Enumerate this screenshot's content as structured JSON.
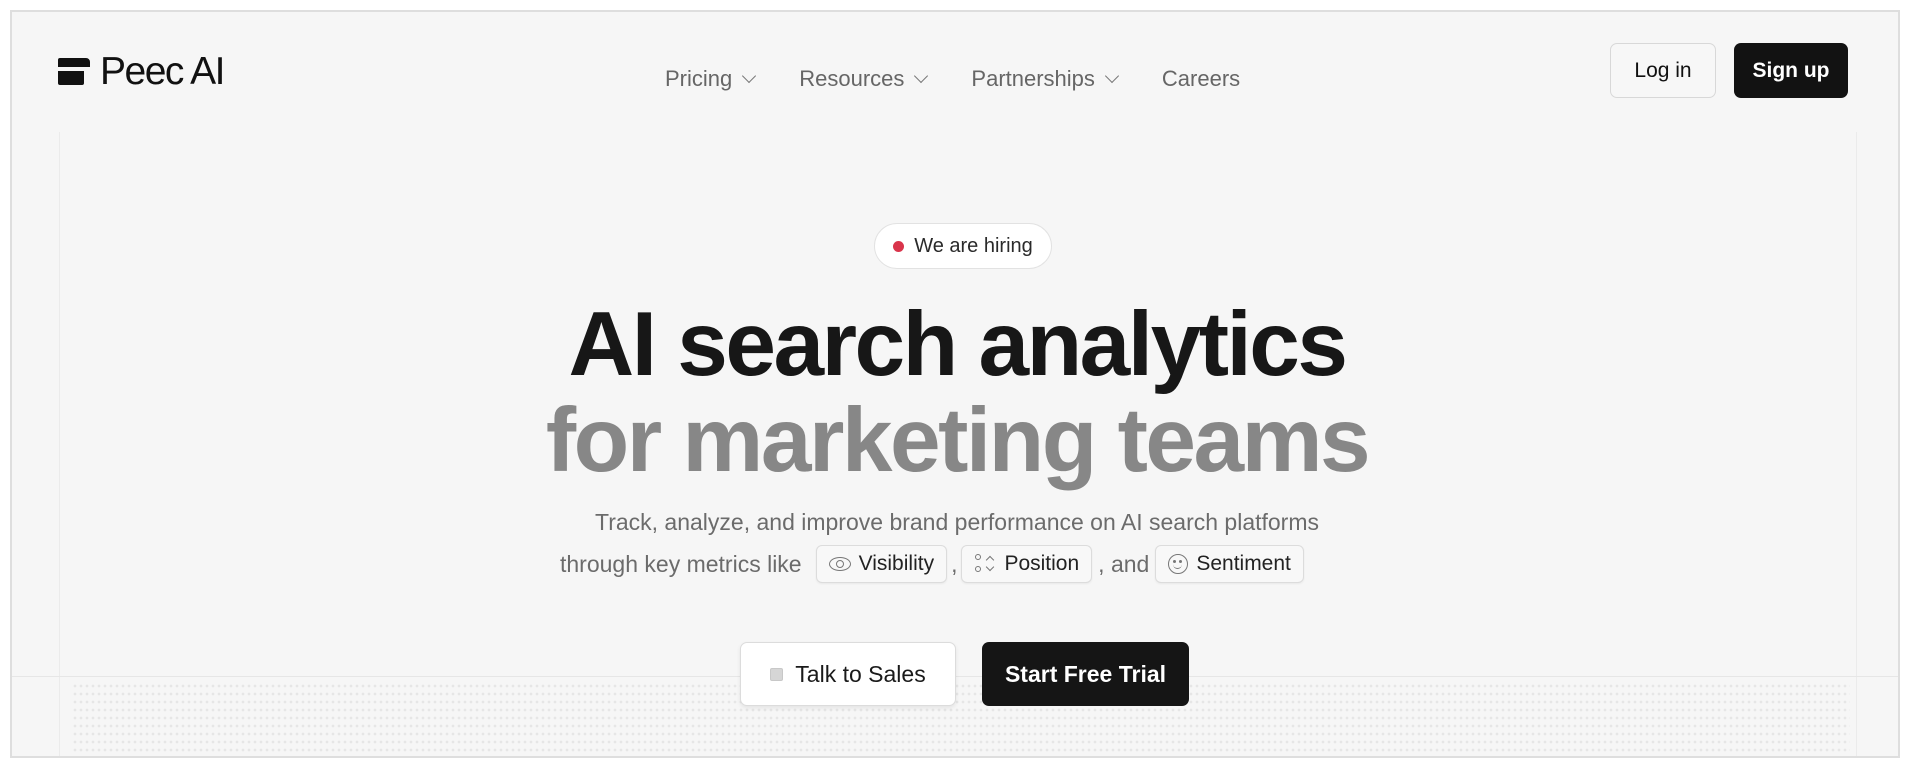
{
  "brand": {
    "name": "Peec AI"
  },
  "nav": {
    "items": [
      {
        "label": "Pricing",
        "has_dropdown": true
      },
      {
        "label": "Resources",
        "has_dropdown": true
      },
      {
        "label": "Partnerships",
        "has_dropdown": true
      },
      {
        "label": "Careers",
        "has_dropdown": false
      }
    ],
    "login_label": "Log in",
    "signup_label": "Sign up"
  },
  "hero": {
    "badge": "We are hiring",
    "title_line1": "AI search analytics",
    "title_line2": "for marketing teams",
    "subtitle_line1": "Track, analyze, and improve brand performance on AI search platforms",
    "subtitle_line2_prefix": "through key metrics like",
    "metrics": [
      {
        "label": "Visibility",
        "icon": "eye-icon"
      },
      {
        "label": "Position",
        "icon": "position-icon"
      },
      {
        "label": "Sentiment",
        "icon": "smile-icon"
      }
    ],
    "separator_comma": ",",
    "separator_and": ", and",
    "cta_secondary": "Talk to Sales",
    "cta_primary": "Start Free Trial"
  },
  "colors": {
    "background": "#f6f6f6",
    "primary_button": "#121212",
    "hiring_dot": "#d9344b",
    "title_muted": "#878787"
  }
}
